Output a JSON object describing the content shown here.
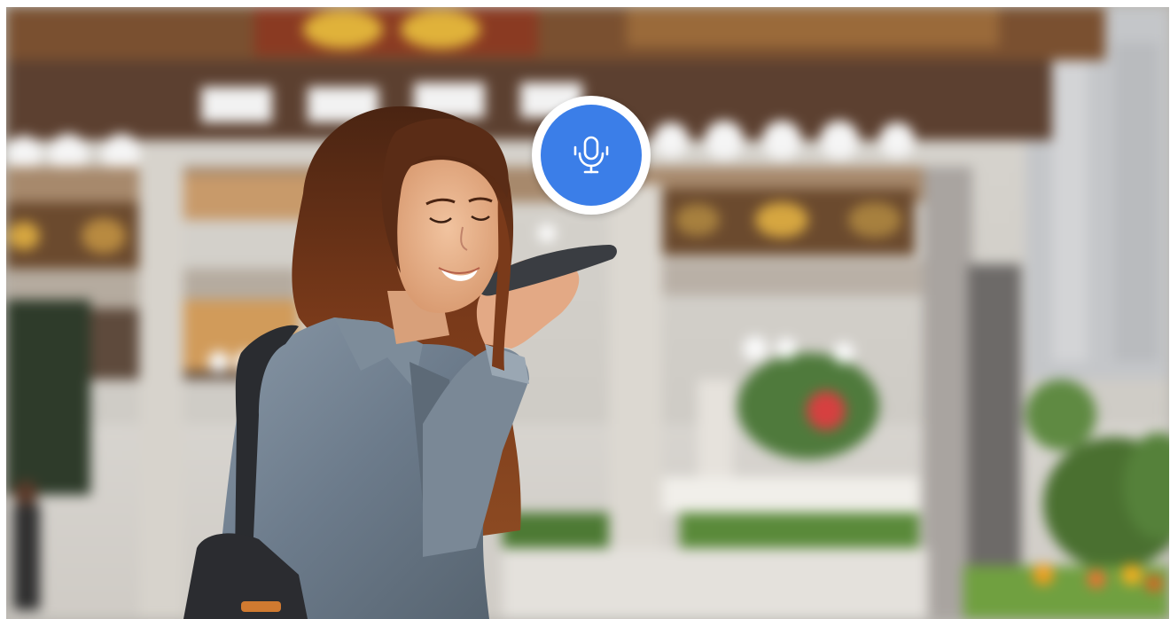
{
  "image": {
    "subject": "",
    "scene": ""
  },
  "overlay": {
    "icon": "microphone-icon",
    "badge_color": "#3b7ee8",
    "ring_color": "#ffffff"
  },
  "colors": {
    "hair": "#6e3418",
    "jacket": "#6f7e8d",
    "skin": "#e8b08c",
    "gate_wood": "#6b4a2e",
    "gold": "#e0b23a",
    "foliage": "#5a8a3a",
    "flowers": "#f0a020"
  }
}
